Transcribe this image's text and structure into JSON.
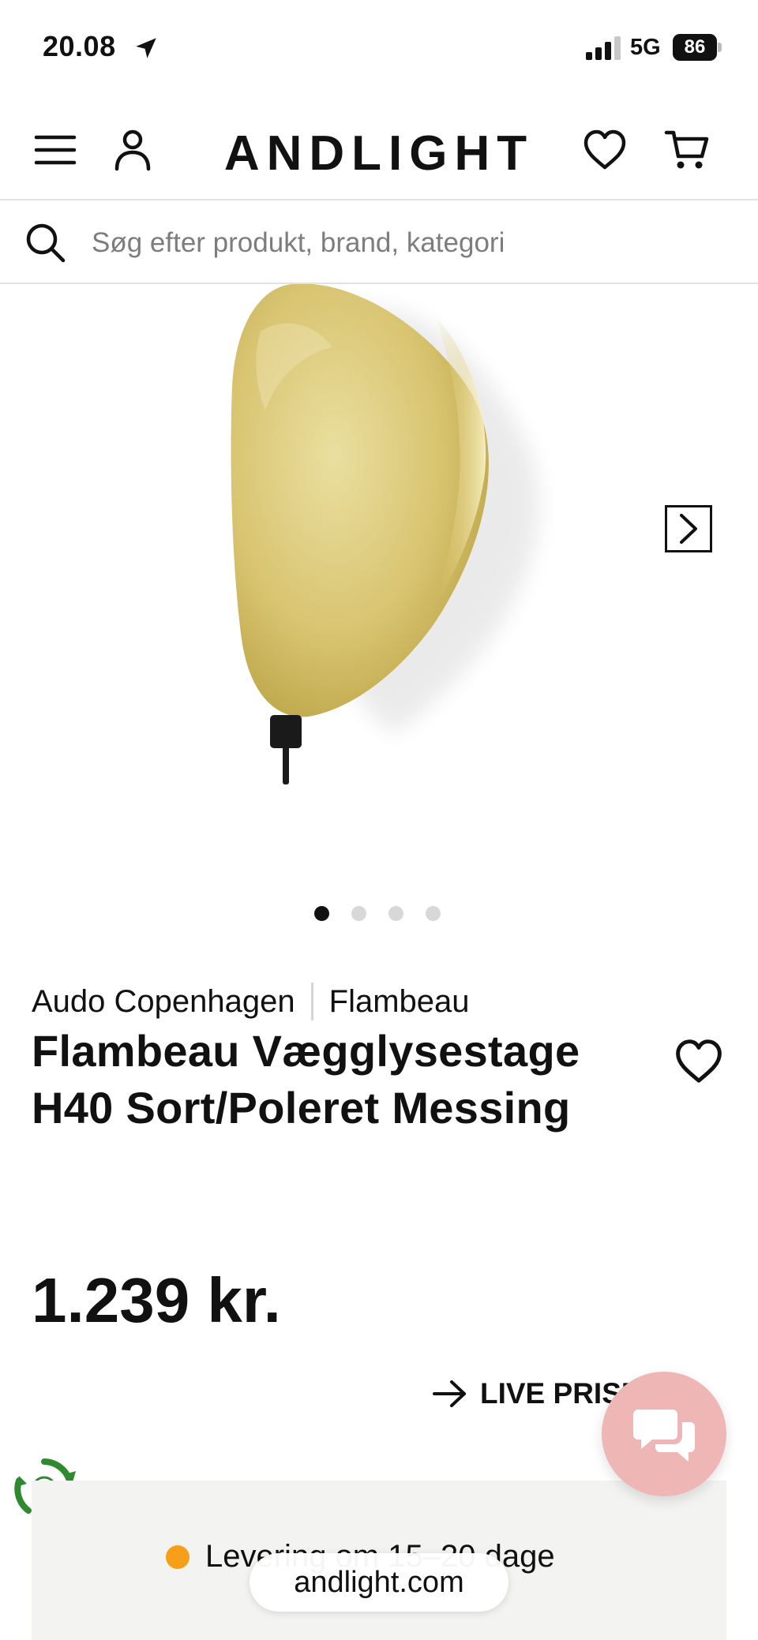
{
  "status_bar": {
    "time": "20.08",
    "network": "5G",
    "battery": "86"
  },
  "header": {
    "brand": "ANDLIGHT"
  },
  "search": {
    "placeholder": "Søg efter produkt, brand, kategori"
  },
  "gallery": {
    "image_count": 4,
    "active_index": 0
  },
  "product": {
    "brand": "Audo Copenhagen",
    "collection": "Flambeau",
    "title": "Flambeau Vægglysestage H40 Sort/Poleret Messing",
    "price": "1.239 kr."
  },
  "price_match": {
    "label": "LIVE PRISM"
  },
  "delivery": {
    "label": "Levering om 15–20 dage",
    "status_color": "#f6a01a"
  },
  "browser": {
    "url": "andlight.com"
  },
  "colors": {
    "chat_button": "#efb6b6",
    "brass": "#d9c36a",
    "eco_green": "#2f8a2f"
  }
}
